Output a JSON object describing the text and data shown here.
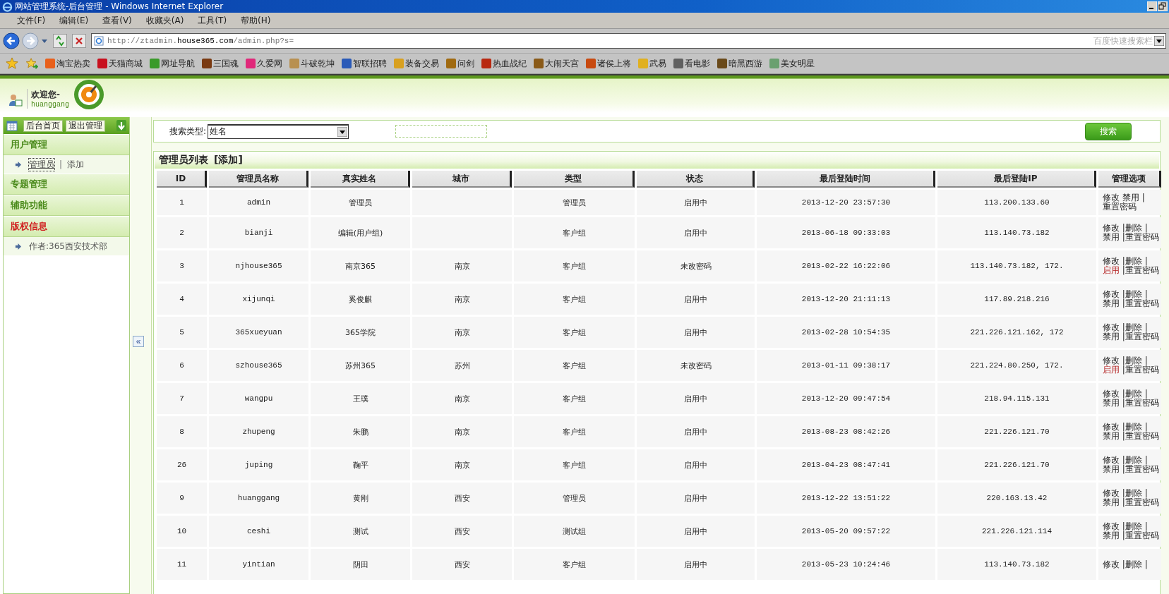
{
  "window": {
    "title": "网站管理系统-后台管理 - Windows Internet Explorer"
  },
  "menu": [
    "文件(F)",
    "编辑(E)",
    "查看(V)",
    "收藏夹(A)",
    "工具(T)",
    "帮助(H)"
  ],
  "address": {
    "url": "http://ztadmin.**house365.com**/admin.php?s="
  },
  "search_box": {
    "placeholder": "百度快速搜索栏"
  },
  "favorites": [
    {
      "label": "淘宝热卖",
      "color": "#e8601c"
    },
    {
      "label": "天猫商城",
      "color": "#c8101e"
    },
    {
      "label": "网址导航",
      "color": "#3a9a2a"
    },
    {
      "label": "三国魂",
      "color": "#7a3a12"
    },
    {
      "label": "久爱网",
      "color": "#e0287a"
    },
    {
      "label": "斗破乾坤",
      "color": "#b89050"
    },
    {
      "label": "智联招聘",
      "color": "#2a5ab8"
    },
    {
      "label": "装备交易",
      "color": "#d8a020"
    },
    {
      "label": "问剑",
      "color": "#a06a10"
    },
    {
      "label": "热血战纪",
      "color": "#b82810"
    },
    {
      "label": "大闹天宫",
      "color": "#8a5a18"
    },
    {
      "label": "诸侯上将",
      "color": "#c84a10"
    },
    {
      "label": "武易",
      "color": "#e0b020"
    },
    {
      "label": "看电影",
      "color": "#606060"
    },
    {
      "label": "暗黑西游",
      "color": "#6a4a1a"
    },
    {
      "label": "美女明星",
      "color": "#6aa070"
    }
  ],
  "header": {
    "greeting": "欢迎您-",
    "user": "huanggang"
  },
  "sidebar": {
    "buttons": [
      "后台首页",
      "退出管理"
    ],
    "sections": [
      {
        "title": "用户管理",
        "alert": false,
        "separator": "|",
        "items": [
          {
            "label": "管理员",
            "selected": true
          },
          {
            "label": "添加",
            "selected": false
          }
        ]
      },
      {
        "title": "专题管理",
        "alert": false
      },
      {
        "title": "辅助功能",
        "alert": false
      },
      {
        "title": "版权信息",
        "alert": true,
        "items": [
          {
            "label": "作者:365西安技术部",
            "selected": false
          }
        ]
      }
    ]
  },
  "collapse_button": "«",
  "search": {
    "label": "搜索类型:",
    "type": "姓名",
    "button": "搜索"
  },
  "list": {
    "title": "管理员列表",
    "add_link": "[添加]",
    "columns": [
      "ID",
      "管理员名称",
      "真实姓名",
      "城市",
      "类型",
      "状态",
      "最后登陆时间",
      "最后登陆IP",
      "管理选项"
    ],
    "rows": [
      {
        "cells": [
          "1",
          "admin",
          "管理员",
          null,
          "管理员",
          "启用中",
          "2013-12-20 23:57:30",
          "113.200.133.60"
        ],
        "options": [
          {
            "label": "修改",
            "alert": false
          },
          {
            "label": "禁用",
            "sep": "|",
            "alert": false
          },
          {
            "label": "重置密码",
            "alert": false
          }
        ]
      },
      {
        "cells": [
          "2",
          "bianji",
          "编辑(用户组)",
          null,
          "客户组",
          "启用中",
          "2013-06-18 09:33:03",
          "113.140.73.182"
        ],
        "options": [
          {
            "label": "修改",
            "sep": "|",
            "alert": false
          },
          {
            "label": "删除",
            "sep": "|",
            "alert": false
          },
          {
            "label": "禁用",
            "sep": "|",
            "alert": false
          },
          {
            "label": "重置密码",
            "alert": false
          }
        ]
      },
      {
        "cells": [
          "3",
          "njhouse365",
          "南京365",
          "南京",
          "客户组",
          "未改密码",
          "2013-02-22 16:22:06",
          "113.140.73.182, 172."
        ],
        "options": [
          {
            "label": "修改",
            "sep": "|",
            "alert": false
          },
          {
            "label": "删除",
            "sep": "|",
            "alert": false
          },
          {
            "label": "启用",
            "sep": "|",
            "alert": true
          },
          {
            "label": "重置密码",
            "alert": false
          }
        ]
      },
      {
        "cells": [
          "4",
          "xijunqi",
          "奚俊麒",
          "南京",
          "客户组",
          "启用中",
          "2013-12-20 21:11:13",
          "117.89.218.216"
        ],
        "options": [
          {
            "label": "修改",
            "sep": "|",
            "alert": false
          },
          {
            "label": "删除",
            "sep": "|",
            "alert": false
          },
          {
            "label": "禁用",
            "sep": "|",
            "alert": false
          },
          {
            "label": "重置密码",
            "alert": false
          }
        ]
      },
      {
        "cells": [
          "5",
          "365xueyuan",
          "365学院",
          "南京",
          "客户组",
          "启用中",
          "2013-02-28 10:54:35",
          "221.226.121.162, 172"
        ],
        "options": [
          {
            "label": "修改",
            "sep": "|",
            "alert": false
          },
          {
            "label": "删除",
            "sep": "|",
            "alert": false
          },
          {
            "label": "禁用",
            "sep": "|",
            "alert": false
          },
          {
            "label": "重置密码",
            "alert": false
          }
        ]
      },
      {
        "cells": [
          "6",
          "szhouse365",
          "苏州365",
          "苏州",
          "客户组",
          "未改密码",
          "2013-01-11 09:38:17",
          "221.224.80.250, 172."
        ],
        "options": [
          {
            "label": "修改",
            "sep": "|",
            "alert": false
          },
          {
            "label": "删除",
            "sep": "|",
            "alert": false
          },
          {
            "label": "启用",
            "sep": "|",
            "alert": true
          },
          {
            "label": "重置密码",
            "alert": false
          }
        ]
      },
      {
        "cells": [
          "7",
          "wangpu",
          "王璞",
          "南京",
          "客户组",
          "启用中",
          "2013-12-20 09:47:54",
          "218.94.115.131"
        ],
        "options": [
          {
            "label": "修改",
            "sep": "|",
            "alert": false
          },
          {
            "label": "删除",
            "sep": "|",
            "alert": false
          },
          {
            "label": "禁用",
            "sep": "|",
            "alert": false
          },
          {
            "label": "重置密码",
            "alert": false
          }
        ]
      },
      {
        "cells": [
          "8",
          "zhupeng",
          "朱鹏",
          "南京",
          "客户组",
          "启用中",
          "2013-08-23 08:42:26",
          "221.226.121.70"
        ],
        "options": [
          {
            "label": "修改",
            "sep": "|",
            "alert": false
          },
          {
            "label": "删除",
            "sep": "|",
            "alert": false
          },
          {
            "label": "禁用",
            "sep": "|",
            "alert": false
          },
          {
            "label": "重置密码",
            "alert": false
          }
        ]
      },
      {
        "cells": [
          "26",
          "juping",
          "鞠平",
          "南京",
          "客户组",
          "启用中",
          "2013-04-23 08:47:41",
          "221.226.121.70"
        ],
        "options": [
          {
            "label": "修改",
            "sep": "|",
            "alert": false
          },
          {
            "label": "删除",
            "sep": "|",
            "alert": false
          },
          {
            "label": "禁用",
            "sep": "|",
            "alert": false
          },
          {
            "label": "重置密码",
            "alert": false
          }
        ]
      },
      {
        "cells": [
          "9",
          "huanggang",
          "黄刚",
          "西安",
          "管理员",
          "启用中",
          "2013-12-22 13:51:22",
          "220.163.13.42"
        ],
        "options": [
          {
            "label": "修改",
            "sep": "|",
            "alert": false
          },
          {
            "label": "删除",
            "sep": "|",
            "alert": false
          },
          {
            "label": "禁用",
            "sep": "|",
            "alert": false
          },
          {
            "label": "重置密码",
            "alert": false
          }
        ]
      },
      {
        "cells": [
          "10",
          "ceshi",
          "测试",
          "西安",
          "测试组",
          "启用中",
          "2013-05-20 09:57:22",
          "221.226.121.114"
        ],
        "options": [
          {
            "label": "修改",
            "sep": "|",
            "alert": false
          },
          {
            "label": "删除",
            "sep": "|",
            "alert": false
          },
          {
            "label": "禁用",
            "sep": "|",
            "alert": false
          },
          {
            "label": "重置密码",
            "alert": false
          }
        ]
      },
      {
        "cells": [
          "11",
          "yintian",
          "阴田",
          "西安",
          "客户组",
          "启用中",
          "2013-05-23 10:24:46",
          "113.140.73.182"
        ],
        "options": [
          {
            "label": "修改",
            "sep": "|",
            "alert": false
          },
          {
            "label": "删除",
            "sep": "|",
            "alert": false
          }
        ]
      }
    ]
  }
}
